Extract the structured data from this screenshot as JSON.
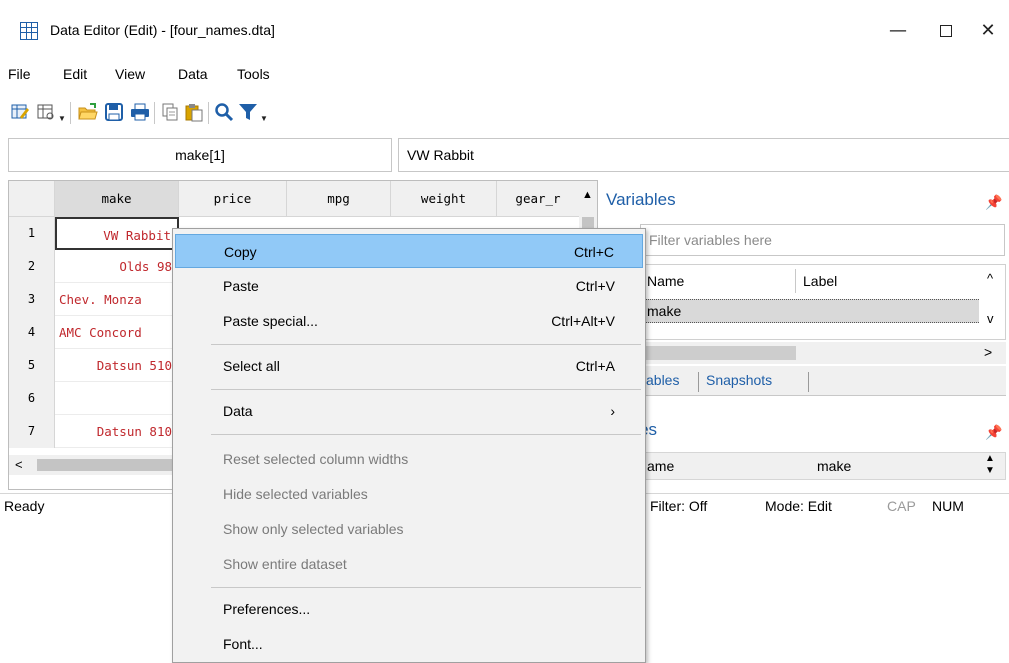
{
  "window": {
    "title": "Data Editor (Edit) - [four_names.dta]",
    "minimize_glyph": "—",
    "close_glyph": "✕"
  },
  "menubar": [
    "File",
    "Edit",
    "View",
    "Data",
    "Tools"
  ],
  "toolbar": {
    "icons": [
      "edit-mode-icon",
      "browse-mode-icon",
      "open-icon",
      "save-icon",
      "print-icon",
      "copy-icon",
      "paste-icon",
      "find-icon",
      "filter-icon"
    ]
  },
  "cellbar": {
    "reference": "make[1]",
    "value": "VW Rabbit"
  },
  "grid": {
    "columns": [
      "make",
      "price",
      "mpg",
      "weight",
      "gear_r"
    ],
    "rows": [
      {
        "num": "1",
        "make": "VW Rabbit"
      },
      {
        "num": "2",
        "make": "Olds 98"
      },
      {
        "num": "3",
        "make": "Chev. Monza"
      },
      {
        "num": "4",
        "make": "AMC Concord"
      },
      {
        "num": "5",
        "make": "Datsun 510"
      },
      {
        "num": "6",
        "make": ""
      },
      {
        "num": "7",
        "make": "Datsun 810"
      }
    ]
  },
  "status": {
    "ready": "Ready",
    "filter": "Filter: Off",
    "mode": "Mode: Edit",
    "cap": "CAP",
    "num": "NUM"
  },
  "variables_panel": {
    "title": "Variables",
    "filter_placeholder": "Filter variables here",
    "col_name": "Name",
    "col_label": "Label",
    "selected_variable": "make",
    "tabs": [
      "ables",
      "Snapshots"
    ]
  },
  "properties_panel": {
    "title": "perties",
    "name_label": "ame",
    "name_value": "make"
  },
  "context_menu": {
    "groups": [
      [
        {
          "label": "Copy",
          "shortcut": "Ctrl+C",
          "state": "highlighted"
        },
        {
          "label": "Paste",
          "shortcut": "Ctrl+V",
          "state": "enabled"
        },
        {
          "label": "Paste special...",
          "shortcut": "Ctrl+Alt+V",
          "state": "enabled"
        }
      ],
      [
        {
          "label": "Select all",
          "shortcut": "Ctrl+A",
          "state": "enabled"
        }
      ],
      [
        {
          "label": "Data",
          "shortcut": "›",
          "state": "enabled"
        }
      ],
      [
        {
          "label": "Reset selected column widths",
          "shortcut": "",
          "state": "disabled"
        },
        {
          "label": "Hide selected variables",
          "shortcut": "",
          "state": "disabled"
        },
        {
          "label": "Show only selected variables",
          "shortcut": "",
          "state": "disabled"
        },
        {
          "label": "Show entire dataset",
          "shortcut": "",
          "state": "disabled"
        }
      ],
      [
        {
          "label": "Preferences...",
          "shortcut": "",
          "state": "enabled"
        },
        {
          "label": "Font...",
          "shortcut": "",
          "state": "enabled"
        }
      ]
    ]
  }
}
